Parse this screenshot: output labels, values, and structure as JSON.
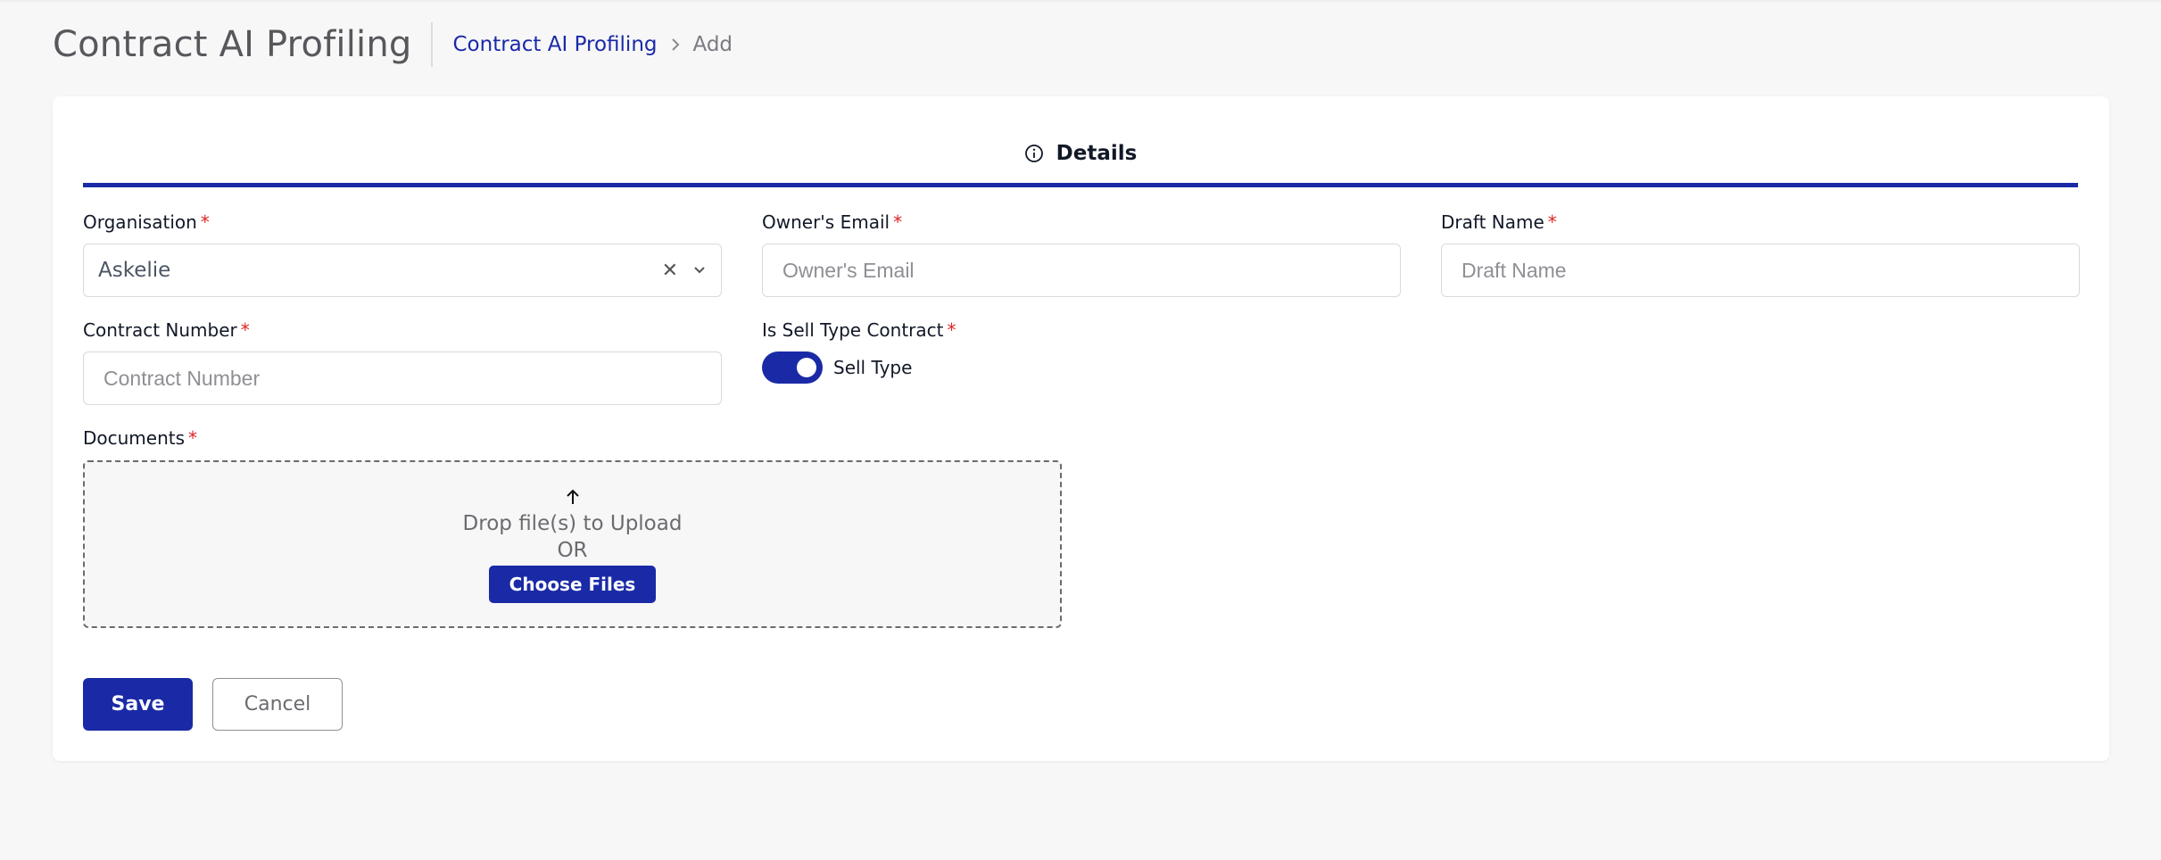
{
  "header": {
    "title": "Contract AI Profiling",
    "breadcrumb": {
      "link": "Contract AI Profiling",
      "current": "Add"
    }
  },
  "tabs": [
    {
      "label": "Details",
      "icon": "info-icon",
      "active": true
    }
  ],
  "form": {
    "organisation": {
      "label": "Organisation",
      "value": "Askelie"
    },
    "owner_email": {
      "label": "Owner's Email",
      "placeholder": "Owner's Email",
      "value": ""
    },
    "draft_name": {
      "label": "Draft Name",
      "placeholder": "Draft Name",
      "value": ""
    },
    "contract_number": {
      "label": "Contract Number",
      "placeholder": "Contract Number",
      "value": ""
    },
    "sell_type": {
      "label": "Is Sell Type Contract",
      "toggle_label": "Sell Type",
      "checked": true
    },
    "documents": {
      "label": "Documents",
      "drop_text": "Drop file(s) to Upload",
      "or_text": "OR",
      "choose_label": "Choose Files"
    },
    "required_mark": "*"
  },
  "actions": {
    "save": "Save",
    "cancel": "Cancel"
  },
  "colors": {
    "primary": "#1a2aa6",
    "required": "#e02424",
    "background": "#f7f7f8"
  }
}
